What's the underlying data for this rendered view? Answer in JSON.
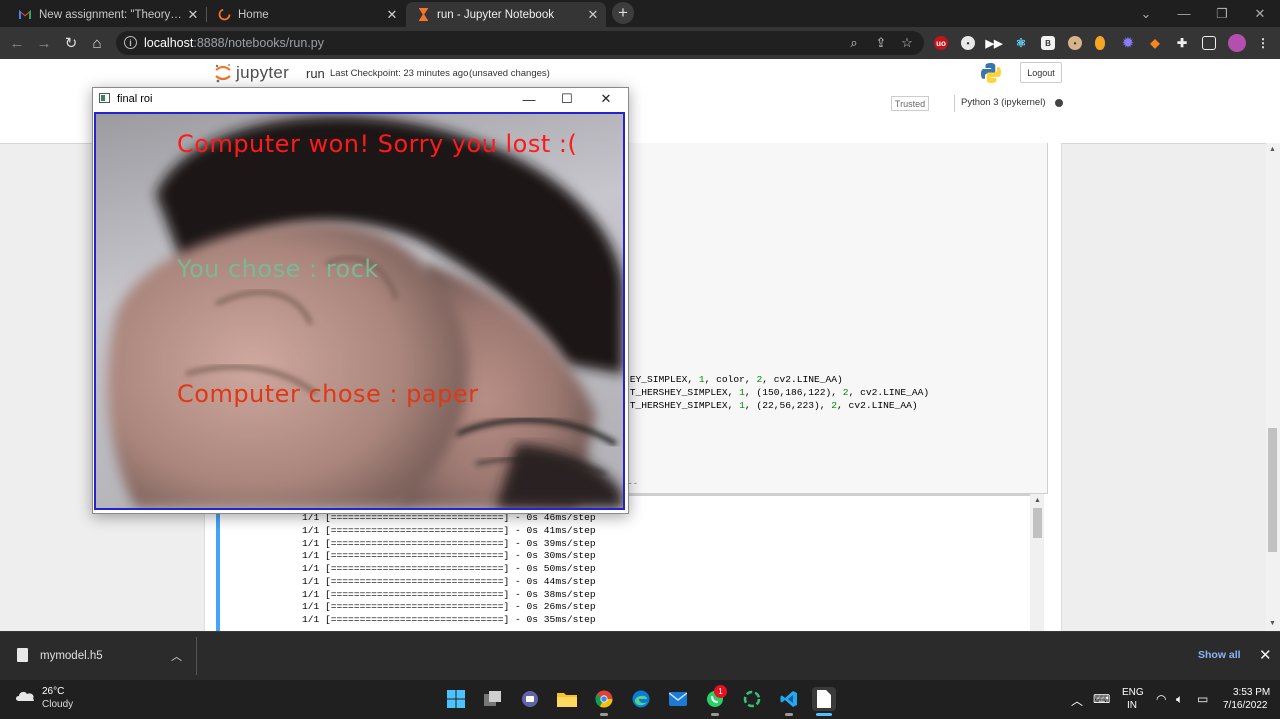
{
  "browser": {
    "tabs": [
      {
        "label": "New assignment: \"Theory and La",
        "icon": "gmail-icon",
        "active": false
      },
      {
        "label": "Home",
        "icon": "jupyter-loading-icon",
        "active": false
      },
      {
        "label": "run - Jupyter Notebook",
        "icon": "hourglass-icon",
        "active": true
      }
    ],
    "new_tab_label": "+",
    "url_host": "localhost",
    "url_rest": ":8888/notebooks/run.py",
    "extensions": [
      "ublock-icon",
      "ghost-icon",
      "forward-icon",
      "react-icon",
      "b-icon",
      "face-icon",
      "avocado-icon",
      "gear-purple-icon",
      "fox-icon",
      "puzzle-icon",
      "sidebar-icon",
      "profile-icon"
    ]
  },
  "jupyter": {
    "logo_text": "jupyter",
    "notebook_name": "run",
    "checkpoint": "Last Checkpoint: 23 minutes ago",
    "unsaved": "(unsaved changes)",
    "logout": "Logout",
    "trusted": "Trusted",
    "kernel": "Python 3 (ipykernel)",
    "code_lines": [
      {
        "pre": "HEY_SIMPLEX, ",
        "n1": "1",
        "mid": ", color, ",
        "n2": "2",
        "post": ", cv2.LINE_AA)"
      },
      {
        "pre": "NT_HERSHEY_SIMPLEX, ",
        "n1": "1",
        "mid": ", (150,186,122), ",
        "n2": "2",
        "post": ", cv2.LINE_AA)"
      },
      {
        "pre": "NT_HERSHEY_SIMPLEX, ",
        "n1": "1",
        "mid": ", (22,56,223), ",
        "n2": "2",
        "post": ", cv2.LINE_AA)"
      }
    ],
    "prompt_separator": "---",
    "output_lines": [
      "1/1 [==============================] - 0s 46ms/step",
      "1/1 [==============================] - 0s 41ms/step",
      "1/1 [==============================] - 0s 39ms/step",
      "1/1 [==============================] - 0s 30ms/step",
      "1/1 [==============================] - 0s 50ms/step",
      "1/1 [==============================] - 0s 44ms/step",
      "1/1 [==============================] - 0s 38ms/step",
      "1/1 [==============================] - 0s 26ms/step",
      "1/1 [==============================] - 0s 35ms/step"
    ]
  },
  "roi_window": {
    "title": "final roi",
    "result_text": "Computer won! Sorry you lost :(",
    "user_choice_text": "You chose : rock",
    "computer_choice_text": "Computer chose : paper",
    "colors": {
      "result": "#ff1a1a",
      "user": "#7ab996",
      "computer": "#df3816",
      "border": "#2323cf"
    }
  },
  "download_shelf": {
    "file_name": "mymodel.h5",
    "show_all": "Show all"
  },
  "taskbar": {
    "temperature": "26°C",
    "weather": "Cloudy",
    "lang_1": "ENG",
    "lang_2": "IN",
    "time": "3:53 PM",
    "date": "7/16/2022",
    "whatsapp_badge": "1",
    "apps": [
      "start-icon",
      "task-view-icon",
      "teams-icon",
      "file-explorer-icon",
      "chrome-icon",
      "edge-icon",
      "mail-icon",
      "whatsapp-icon",
      "loader-icon",
      "vscode-icon",
      "file-icon"
    ]
  }
}
